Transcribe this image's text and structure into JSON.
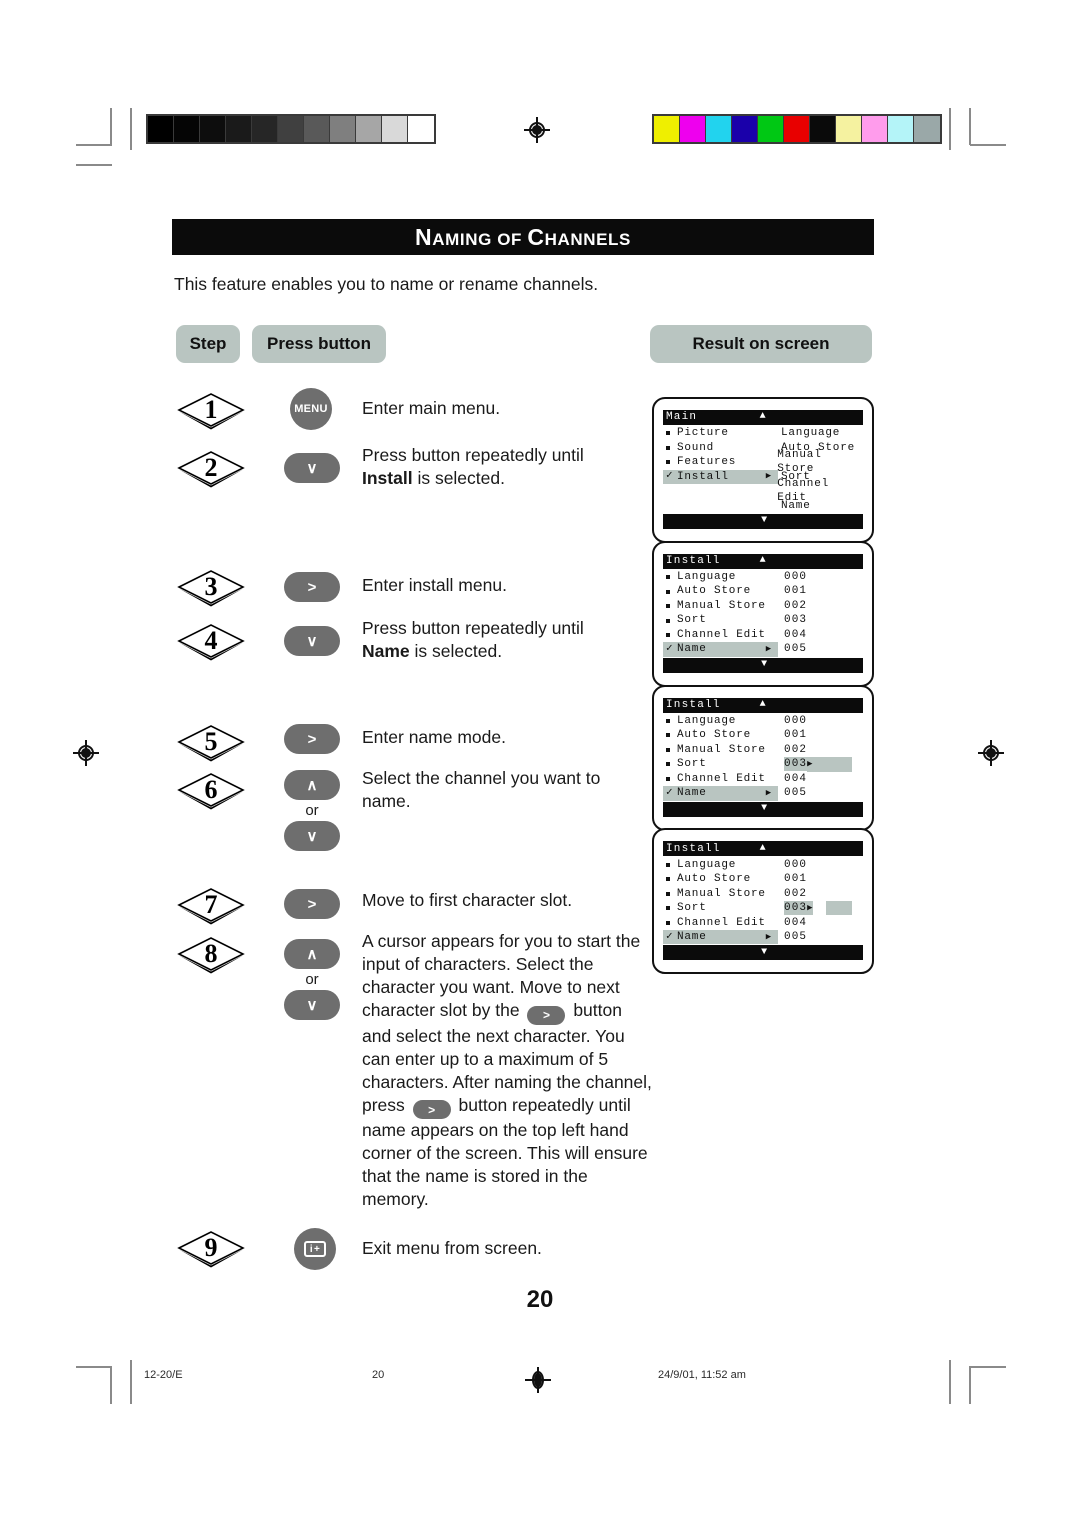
{
  "document": {
    "title": "Naming of Channels",
    "title_display": {
      "big1": "N",
      "rest1": "AMING",
      "mid": "OF",
      "big2": "C",
      "rest2": "HANNELS"
    },
    "intro": "This feature enables you to name or rename channels.",
    "page_number": "20"
  },
  "table_headers": {
    "step": "Step",
    "press_button": "Press button",
    "result": "Result on screen"
  },
  "steps": [
    {
      "number": "1",
      "button": {
        "icon": "menu-button",
        "label": "MENU"
      },
      "text_plain": "Enter main menu."
    },
    {
      "number": "2",
      "button": {
        "icon": "chevron-down-button",
        "label": "∨"
      },
      "text_line1": "Press button repeatedly until",
      "text_bold": "Install",
      "text_line2_tail": " is selected."
    },
    {
      "number": "3",
      "button": {
        "icon": "chevron-right-button",
        "label": ">"
      },
      "text_plain": "Enter install menu."
    },
    {
      "number": "4",
      "button": {
        "icon": "chevron-down-button",
        "label": "∨"
      },
      "text_line1": "Press button repeatedly until",
      "text_bold": "Name",
      "text_line2_tail": " is selected."
    },
    {
      "number": "5",
      "button": {
        "icon": "chevron-right-button",
        "label": ">"
      },
      "text_plain": "Enter name mode."
    },
    {
      "number": "6",
      "button_up": {
        "icon": "chevron-up-button",
        "label": "∧"
      },
      "or_label": "or",
      "button_down": {
        "icon": "chevron-down-button",
        "label": "∨"
      },
      "text_plain": "Select the channel you want to name."
    },
    {
      "number": "7",
      "button": {
        "icon": "chevron-right-button",
        "label": ">"
      },
      "text_plain": "Move to first character slot."
    },
    {
      "number": "8",
      "button_up": {
        "icon": "chevron-up-button",
        "label": "∧"
      },
      "or_label": "or",
      "button_down": {
        "icon": "chevron-down-button",
        "label": "∨"
      },
      "text_parts": {
        "p1": "A cursor appears for you to start the input of characters. Select the character you want. Move to next character slot by the ",
        "inline_btn_1": ">",
        "p2": " button and select the next character. You can enter up to a maximum of 5 characters. After naming the channel, press ",
        "inline_btn_2": ">",
        "p3": " button repeatedly until name appears on the top left hand corner of the screen. This will ensure that the name is stored in the memory."
      }
    },
    {
      "number": "9",
      "button": {
        "icon": "info-plus-button",
        "label": "i+"
      },
      "text_plain": "Exit menu from screen."
    }
  ],
  "osd_screens": [
    {
      "id": "main-menu",
      "header_title": "Main",
      "header_arrow": "▲",
      "footer_arrow": "▼",
      "left_items": [
        {
          "label": "Picture",
          "marker": "bullet",
          "selected": false,
          "arrow": ""
        },
        {
          "label": "Sound",
          "marker": "bullet",
          "selected": false,
          "arrow": ""
        },
        {
          "label": "Features",
          "marker": "bullet",
          "selected": false,
          "arrow": ""
        },
        {
          "label": "Install",
          "marker": "checkmark",
          "selected": true,
          "arrow": "▶"
        }
      ],
      "right_items": [
        {
          "label": "Language",
          "value": ""
        },
        {
          "label": "Auto Store",
          "value": ""
        },
        {
          "label": "Manual Store",
          "value": ""
        },
        {
          "label": "Sort",
          "value": ""
        },
        {
          "label": "Channel Edit",
          "value": ""
        },
        {
          "label": "Name",
          "value": ""
        }
      ]
    },
    {
      "id": "install-menu",
      "header_title": "Install",
      "header_arrow": "▲",
      "footer_arrow": "▼",
      "left_items": [
        {
          "label": "Language",
          "marker": "bullet",
          "selected": false,
          "arrow": ""
        },
        {
          "label": "Auto Store",
          "marker": "bullet",
          "selected": false,
          "arrow": ""
        },
        {
          "label": "Manual Store",
          "marker": "bullet",
          "selected": false,
          "arrow": ""
        },
        {
          "label": "Sort",
          "marker": "bullet",
          "selected": false,
          "arrow": ""
        },
        {
          "label": "Channel Edit",
          "marker": "bullet",
          "selected": false,
          "arrow": ""
        },
        {
          "label": "Name",
          "marker": "checkmark",
          "selected": true,
          "arrow": "▶"
        }
      ],
      "values": [
        "000",
        "001",
        "002",
        "003",
        "004",
        "005"
      ],
      "value_highlight_index": -1,
      "cursor": false
    },
    {
      "id": "install-menu-channel-selected",
      "header_title": "Install",
      "header_arrow": "▲",
      "footer_arrow": "▼",
      "left_items": [
        {
          "label": "Language",
          "marker": "bullet",
          "selected": false,
          "arrow": ""
        },
        {
          "label": "Auto Store",
          "marker": "bullet",
          "selected": false,
          "arrow": ""
        },
        {
          "label": "Manual Store",
          "marker": "bullet",
          "selected": false,
          "arrow": ""
        },
        {
          "label": "Sort",
          "marker": "bullet",
          "selected": false,
          "arrow": ""
        },
        {
          "label": "Channel Edit",
          "marker": "bullet",
          "selected": false,
          "arrow": ""
        },
        {
          "label": "Name",
          "marker": "checkmark",
          "selected": true,
          "arrow": "▶"
        }
      ],
      "values": [
        "000",
        "001",
        "002",
        "003",
        "004",
        "005"
      ],
      "value_highlight_index": 3,
      "value_highlight_arrow": "▶",
      "cursor": false
    },
    {
      "id": "install-menu-cursor",
      "header_title": "Install",
      "header_arrow": "▲",
      "footer_arrow": "▼",
      "left_items": [
        {
          "label": "Language",
          "marker": "bullet",
          "selected": false,
          "arrow": ""
        },
        {
          "label": "Auto Store",
          "marker": "bullet",
          "selected": false,
          "arrow": ""
        },
        {
          "label": "Manual Store",
          "marker": "bullet",
          "selected": false,
          "arrow": ""
        },
        {
          "label": "Sort",
          "marker": "bullet",
          "selected": false,
          "arrow": ""
        },
        {
          "label": "Channel Edit",
          "marker": "bullet",
          "selected": false,
          "arrow": ""
        },
        {
          "label": "Name",
          "marker": "checkmark",
          "selected": true,
          "arrow": "▶"
        }
      ],
      "values": [
        "000",
        "001",
        "002",
        "003",
        "004",
        "005"
      ],
      "value_highlight_index": 3,
      "value_highlight_arrow": "▶",
      "cursor": true
    }
  ],
  "print_marks": {
    "grayscale_patches": [
      "#000000",
      "#050505",
      "#0d0d0d",
      "#1a1a1a",
      "#262626",
      "#404040",
      "#595959",
      "#7f7f7f",
      "#a6a6a6",
      "#d9d9d9",
      "#ffffff"
    ],
    "color_patches": [
      "#efef00",
      "#ee00ee",
      "#22d3ee",
      "#1a00aa",
      "#00c814",
      "#e80000",
      "#0a0a0a",
      "#f5f2a0",
      "#ff9cec",
      "#b4f4f8",
      "#9aa8a8"
    ]
  },
  "footer": {
    "left": "12-20/E",
    "center": "20",
    "right": "24/9/01, 11:52 am"
  },
  "colors": {
    "header_pill": "#b9c5c1",
    "osd_highlight": "#b9c5c1",
    "osd_bar": "#0b0b0b",
    "remote_button": "#6e6e6e",
    "title_bar": "#0b0b0b"
  }
}
